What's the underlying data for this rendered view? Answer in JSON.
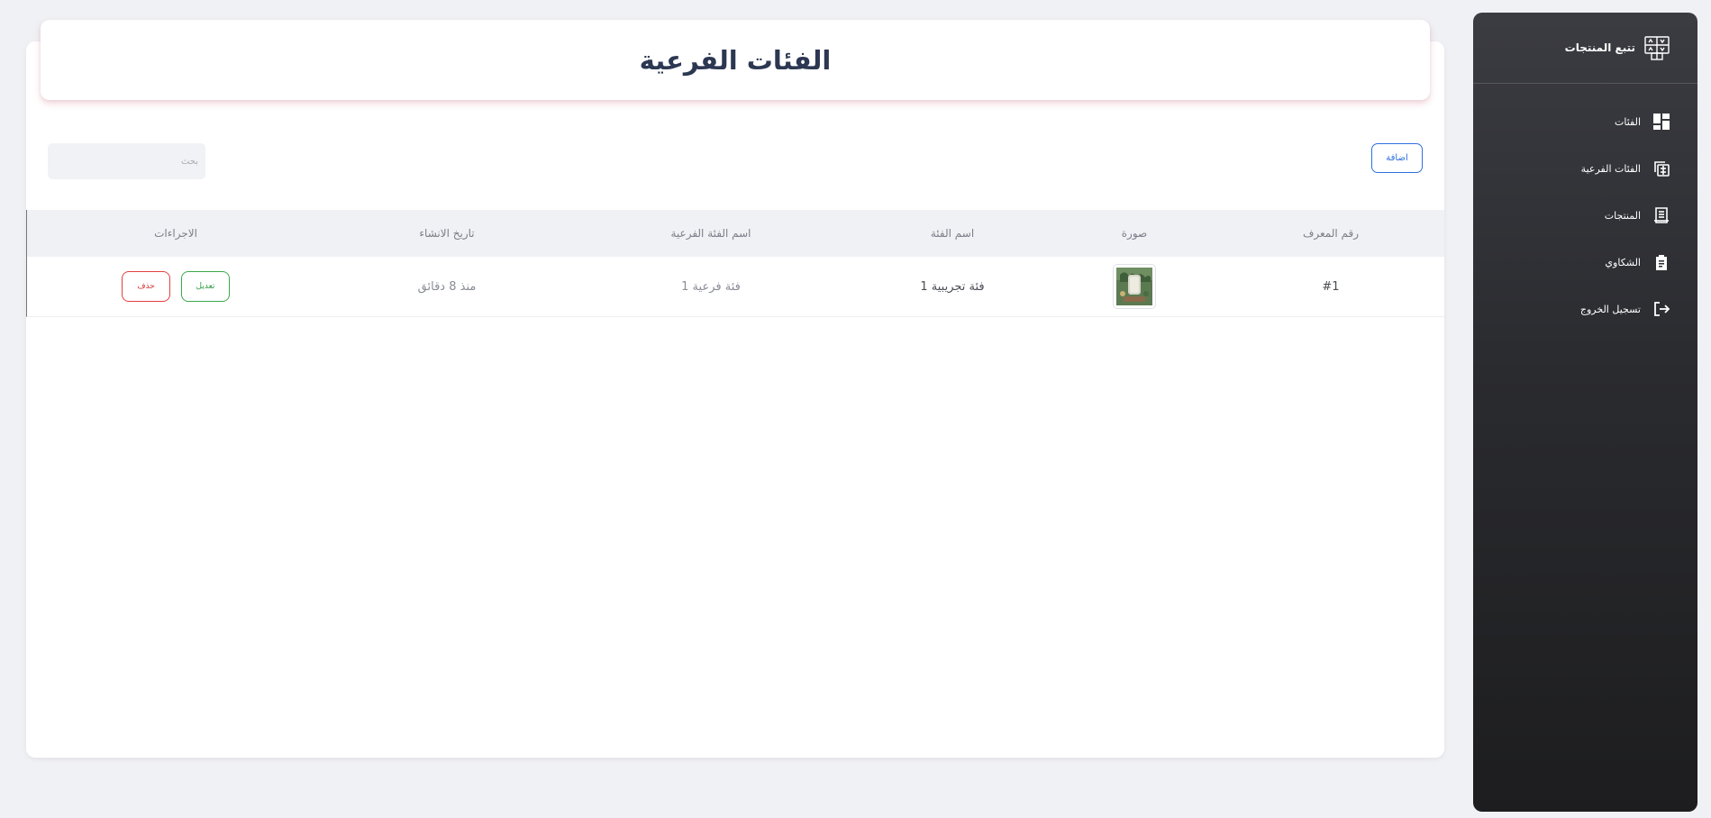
{
  "sidebar": {
    "brand_title": "تتبع المنتجات",
    "items": [
      {
        "label": "الفئات",
        "icon": "dashboard-icon"
      },
      {
        "label": "الفئات الفرعية",
        "icon": "layers-icon"
      },
      {
        "label": "المنتجات",
        "icon": "receipt-icon"
      },
      {
        "label": "الشكاوي",
        "icon": "clipboard-icon"
      },
      {
        "label": "تسجيل الخروج",
        "icon": "logout-icon"
      }
    ]
  },
  "header": {
    "title": "الفئات الفرعية"
  },
  "toolbar": {
    "add_label": "اضافة",
    "search_placeholder": "بحث"
  },
  "table": {
    "columns": [
      "رقم المعرف",
      "صورة",
      "اسم الفئة",
      "اسم الفئة الفرعية",
      "تاريخ الانشاء",
      "الاجراءات"
    ],
    "rows": [
      {
        "id": "#1",
        "image": "product-thumbnail",
        "category": "فئة تجريبية 1",
        "subcategory": "فئة فرعية 1",
        "created": "منذ 8 دقائق",
        "edit_label": "تعديل",
        "delete_label": "حذف"
      }
    ]
  },
  "colors": {
    "sidebar_top": "#3b3c42",
    "sidebar_bottom": "#1d1d1f",
    "accent_blue": "#2f6fde",
    "edit_green": "#3aa84a",
    "delete_red": "#e24040",
    "title_color": "#2c3752"
  }
}
